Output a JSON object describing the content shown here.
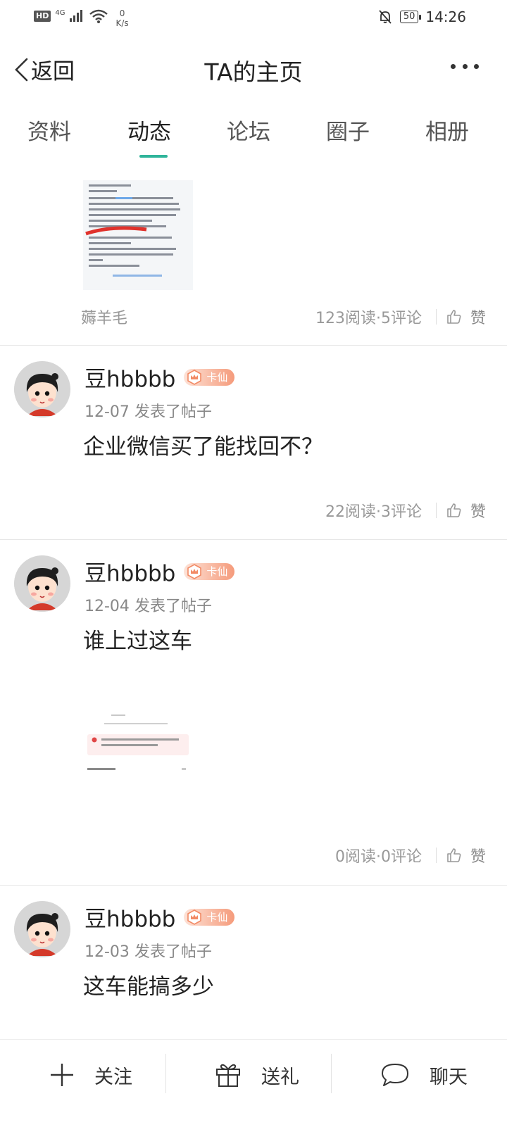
{
  "status_bar": {
    "hd": "HD",
    "network": "4G",
    "speed_value": "0",
    "speed_unit": "K/s",
    "battery": "50",
    "time": "14:26"
  },
  "header": {
    "back_label": "返回",
    "title": "TA的主页"
  },
  "tabs": [
    {
      "label": "资料",
      "active": false
    },
    {
      "label": "动态",
      "active": true
    },
    {
      "label": "论坛",
      "active": false
    },
    {
      "label": "圈子",
      "active": false
    },
    {
      "label": "相册",
      "active": false
    }
  ],
  "posts": [
    {
      "tag": "薅羊毛",
      "stats": "123阅读·5评论",
      "like_label": "赞"
    },
    {
      "author": "豆hbbbb",
      "badge": "卡仙",
      "date": "12-07",
      "action": "发表了帖子",
      "text": "企业微信买了能找回不？",
      "stats": "22阅读·3评论",
      "like_label": "赞"
    },
    {
      "author": "豆hbbbb",
      "badge": "卡仙",
      "date": "12-04",
      "action": "发表了帖子",
      "text": "谁上过这车",
      "stats": "0阅读·0评论",
      "like_label": "赞"
    },
    {
      "author": "豆hbbbb",
      "badge": "卡仙",
      "date": "12-03",
      "action": "发表了帖子",
      "text": "这车能搞多少"
    }
  ],
  "bottom_bar": {
    "follow_label": "关注",
    "gift_label": "送礼",
    "chat_label": "聊天"
  },
  "colors": {
    "accent": "#2fb49a",
    "badge_start": "#fde2d7",
    "badge_end": "#f59b7b"
  }
}
